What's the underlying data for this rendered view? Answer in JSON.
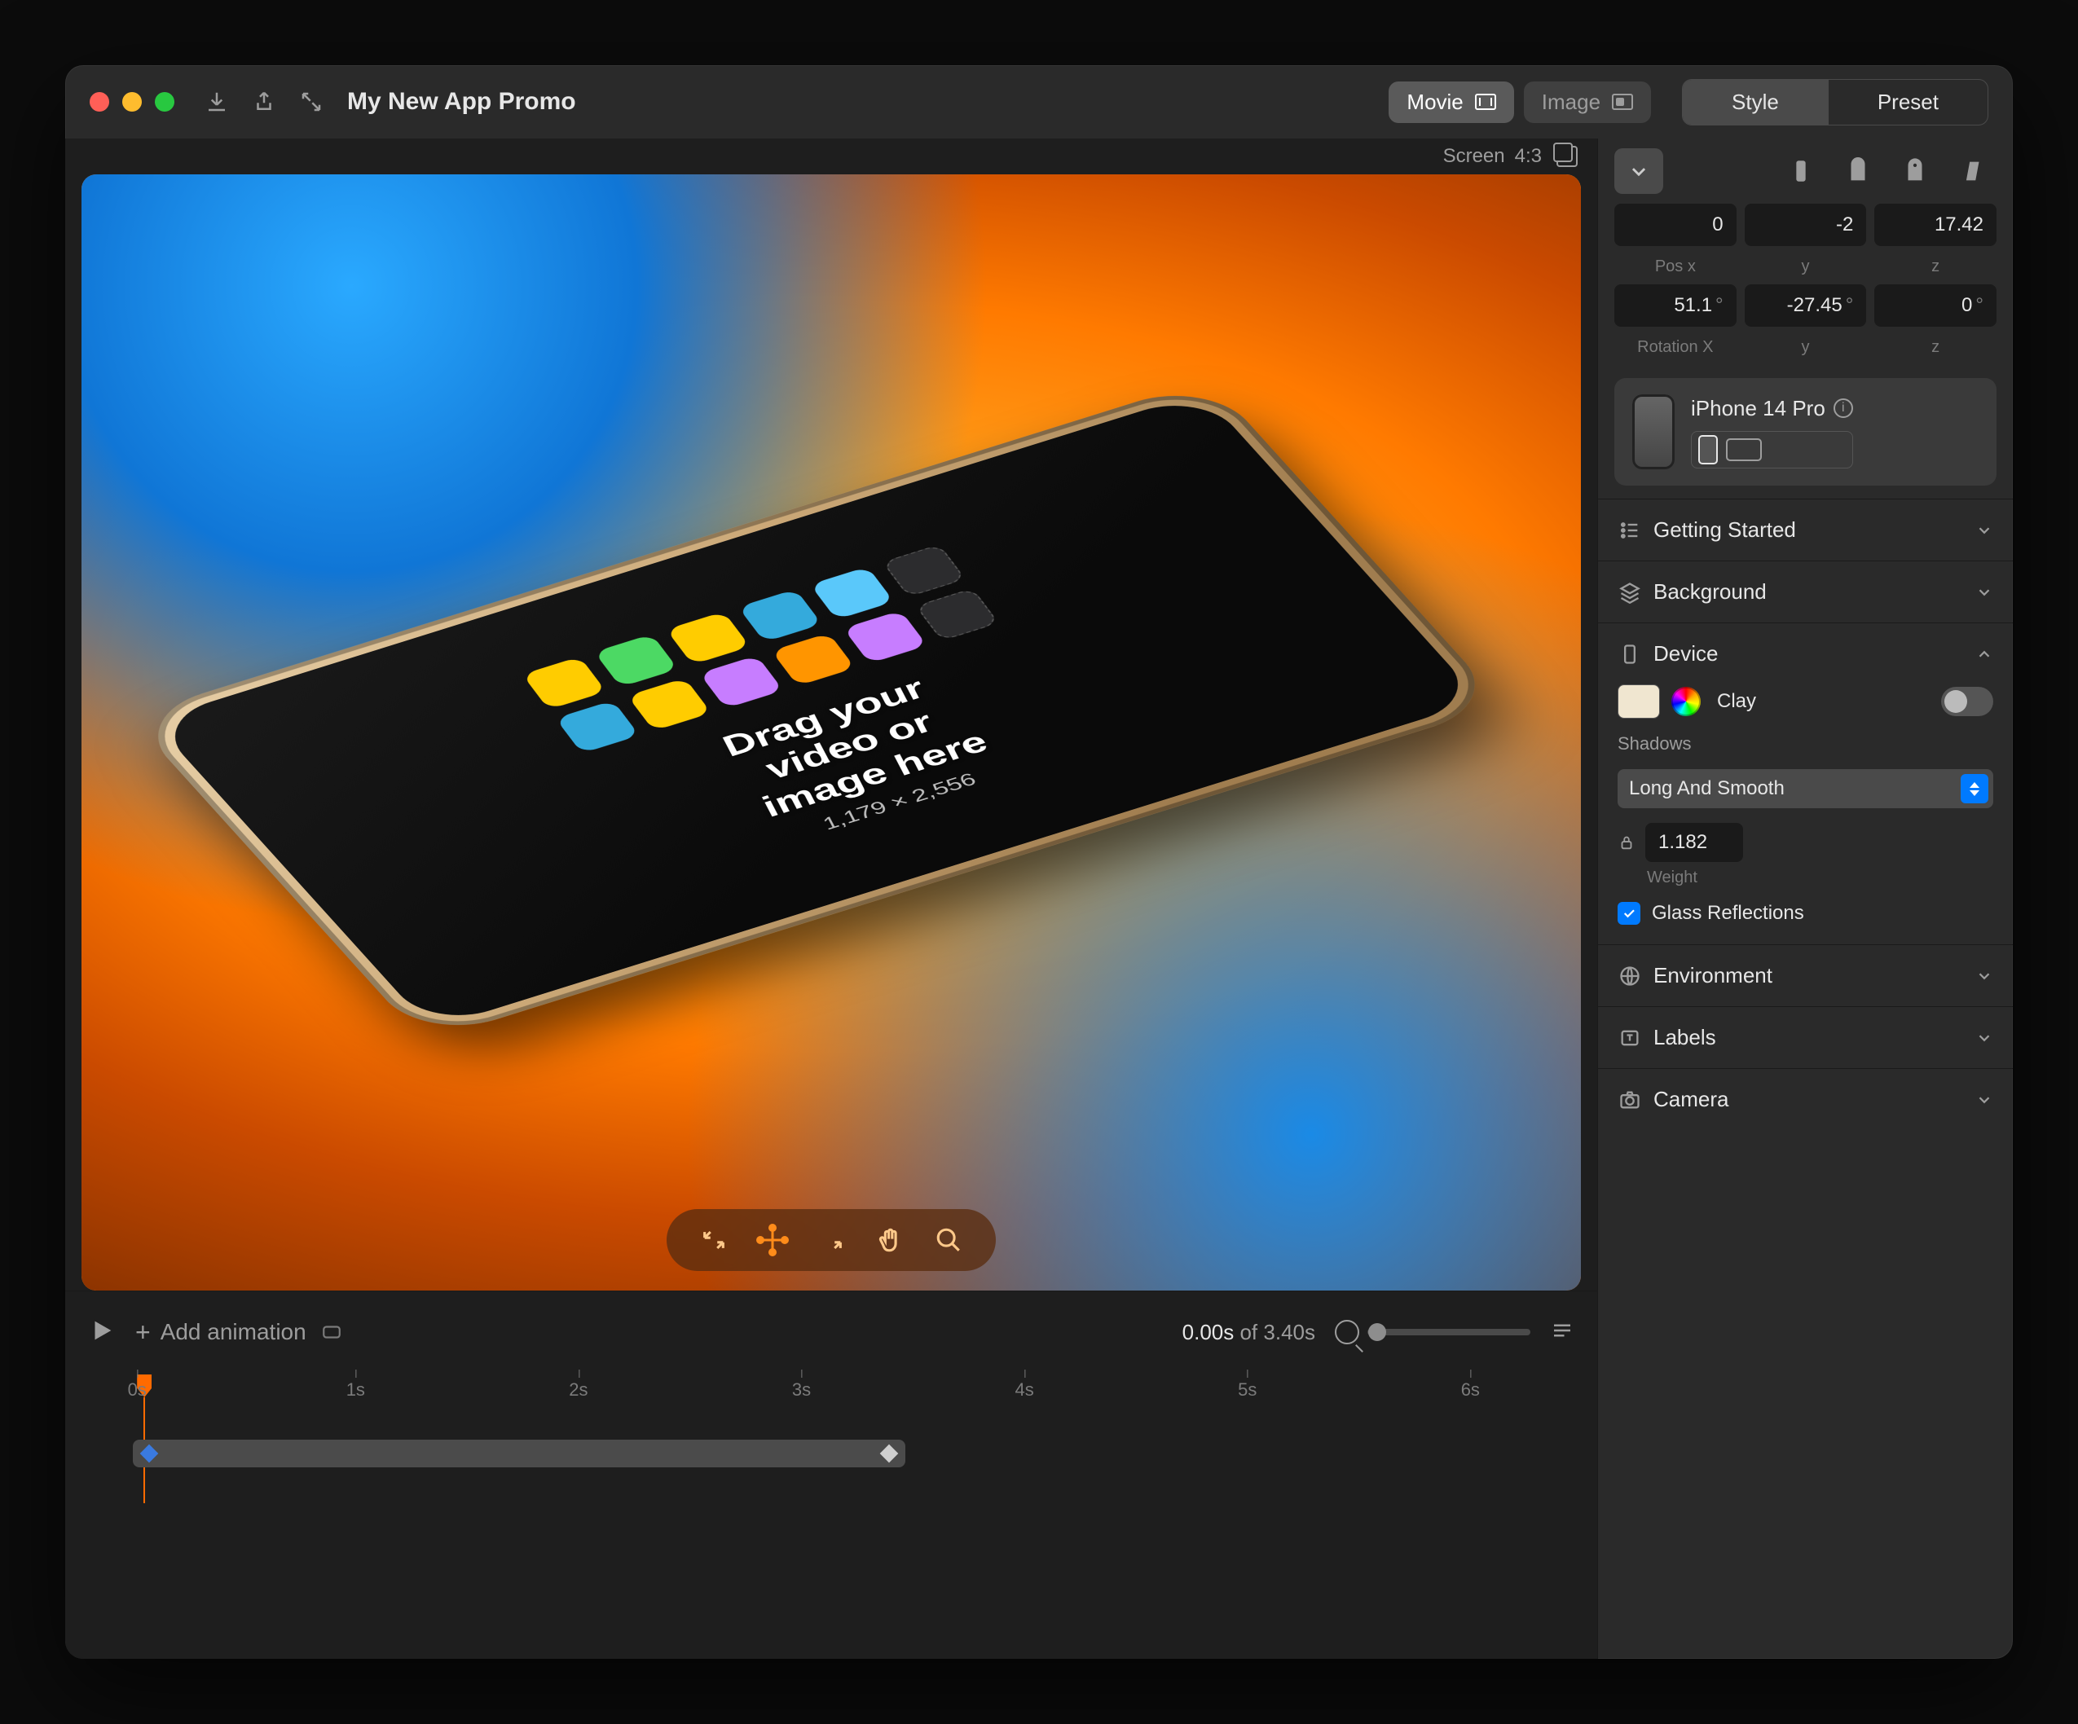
{
  "title": "My New App Promo",
  "mode": {
    "movie": "Movie",
    "image": "Image"
  },
  "tabs": {
    "style": "Style",
    "preset": "Preset"
  },
  "canvas": {
    "screen_label": "Screen",
    "ratio": "4:3",
    "drop_line1": "Drag your",
    "drop_line2": "video or",
    "drop_line3": "image here",
    "dimensions": "1,179 × 2,556"
  },
  "position": {
    "x": "0",
    "y": "-2",
    "z": "17.42",
    "lbl_x": "Pos x",
    "lbl_y": "y",
    "lbl_z": "z"
  },
  "rotation": {
    "x": "51.1",
    "y": "-27.45",
    "z": "0",
    "lbl_x": "Rotation X",
    "lbl_y": "y",
    "lbl_z": "z"
  },
  "device_card": {
    "name": "iPhone 14 Pro"
  },
  "sections": {
    "getting_started": "Getting Started",
    "background": "Background",
    "device": "Device",
    "environment": "Environment",
    "labels": "Labels",
    "camera": "Camera"
  },
  "device_panel": {
    "clay": "Clay",
    "shadows_label": "Shadows",
    "shadows_value": "Long And Smooth",
    "weight_value": "1.182",
    "weight_label": "Weight",
    "glass_reflections": "Glass Reflections"
  },
  "timeline": {
    "add_animation": "Add animation",
    "current": "0.00s",
    "of": " of ",
    "total": "3.40s",
    "ticks": [
      "0s",
      "1s",
      "2s",
      "3s",
      "4s",
      "5s",
      "6s"
    ]
  }
}
